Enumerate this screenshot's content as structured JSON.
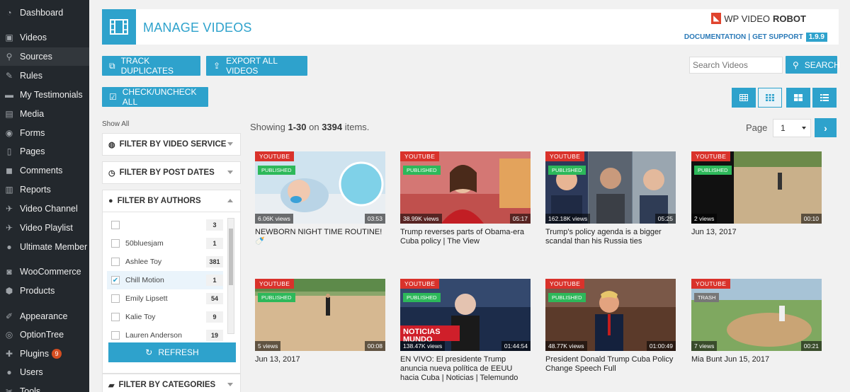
{
  "sidebar": {
    "items": [
      {
        "label": "Dashboard",
        "icon": "dashboard-icon",
        "glyph": "◔"
      },
      {
        "label": "Videos",
        "icon": "videos-icon",
        "glyph": "▣"
      },
      {
        "label": "Sources",
        "icon": "search-icon",
        "glyph": "⚲"
      },
      {
        "label": "Rules",
        "icon": "rules-icon",
        "glyph": "✎"
      },
      {
        "label": "My Testimonials",
        "icon": "testimonials-icon",
        "glyph": "▬"
      },
      {
        "label": "Media",
        "icon": "media-icon",
        "glyph": "▤"
      },
      {
        "label": "Forms",
        "icon": "forms-icon",
        "glyph": "◉"
      },
      {
        "label": "Pages",
        "icon": "pages-icon",
        "glyph": "▯"
      },
      {
        "label": "Comments",
        "icon": "comments-icon",
        "glyph": "◼"
      },
      {
        "label": "Reports",
        "icon": "reports-icon",
        "glyph": "▥"
      },
      {
        "label": "Video Channel",
        "icon": "pin-icon",
        "glyph": "✈"
      },
      {
        "label": "Video Playlist",
        "icon": "pin-icon",
        "glyph": "✈"
      },
      {
        "label": "Ultimate Member",
        "icon": "user-icon",
        "glyph": "●"
      },
      {
        "label": "WooCommerce",
        "icon": "woocommerce-icon",
        "glyph": "◙"
      },
      {
        "label": "Products",
        "icon": "products-icon",
        "glyph": "⬢"
      },
      {
        "label": "Appearance",
        "icon": "appearance-icon",
        "glyph": "✐"
      },
      {
        "label": "OptionTree",
        "icon": "optiontree-icon",
        "glyph": "◎"
      },
      {
        "label": "Plugins",
        "icon": "plugins-icon",
        "glyph": "✚",
        "badge": "9"
      },
      {
        "label": "Users",
        "icon": "users-icon",
        "glyph": "●"
      },
      {
        "label": "Tools",
        "icon": "tools-icon",
        "glyph": "✂"
      }
    ]
  },
  "header": {
    "title": "MANAGE VIDEOS",
    "logo_wp": "WP VIDEO",
    "logo_robot": "ROBOT",
    "documentation": "DOCUMENTATION",
    "separator": "|",
    "support": "GET SUPPORT",
    "version": "1.9.9"
  },
  "toolbar": {
    "track_duplicates": "TRACK DUPLICATES",
    "export_all": "EXPORT ALL VIDEOS",
    "check_all": "CHECK/UNCHECK ALL",
    "search_placeholder": "Search Videos",
    "search_label": "SEARCH"
  },
  "filters": {
    "show_all": "Show All",
    "video_service": "FILTER BY VIDEO SERVICE",
    "post_dates": "FILTER BY POST DATES",
    "authors": "FILTER BY AUTHORS",
    "categories": "FILTER BY CATEGORIES",
    "refresh": "REFRESH",
    "author_list": [
      {
        "name": "",
        "count": "3",
        "checked": false
      },
      {
        "name": "50bluesjam",
        "count": "1",
        "checked": false
      },
      {
        "name": "Ashlee Toy",
        "count": "381",
        "checked": false
      },
      {
        "name": "Chill Motion",
        "count": "1",
        "checked": true
      },
      {
        "name": "Emily Lipsett",
        "count": "54",
        "checked": false
      },
      {
        "name": "Kalie Toy",
        "count": "9",
        "checked": false
      },
      {
        "name": "Lauren Anderson",
        "count": "19",
        "checked": false
      }
    ]
  },
  "listing": {
    "showing_prefix": "Showing ",
    "range": "1-30",
    "on": " on ",
    "total": "3394",
    "suffix": " items.",
    "page_label": "Page",
    "page_value": "1"
  },
  "videos": [
    {
      "service": "YOUTUBE",
      "status": "PUBLISHED",
      "views": "6.06K views",
      "duration": "03:53",
      "title": "NEWBORN NIGHT TIME ROUTINE! 🍼",
      "scene": "baby"
    },
    {
      "service": "YOUTUBE",
      "status": "PUBLISHED",
      "views": "38.99K views",
      "duration": "05:17",
      "title": "Trump reverses parts of Obama-era Cuba policy | The View",
      "scene": "studio"
    },
    {
      "service": "YOUTUBE",
      "status": "PUBLISHED",
      "views": "162.18K views",
      "duration": "05:25",
      "title": "Trump's policy agenda is a bigger scandal than his Russia ties",
      "scene": "panel"
    },
    {
      "service": "YOUTUBE",
      "status": "PUBLISHED",
      "views": "2 views",
      "duration": "00:10",
      "title": "Jun 13, 2017",
      "scene": "field-dark"
    },
    {
      "service": "YOUTUBE",
      "status": "PUBLISHED",
      "views": "5 views",
      "duration": "00:08",
      "title": "Jun 13, 2017",
      "scene": "field"
    },
    {
      "service": "YOUTUBE",
      "status": "PUBLISHED",
      "views": "138.47K views",
      "duration": "01:44:54",
      "title": "EN VIVO: El presidente Trump anuncia nueva política de EEUU hacia Cuba | Noticias | Telemundo",
      "scene": "noticias",
      "overlay": "NOTICIAS MUNDO"
    },
    {
      "service": "YOUTUBE",
      "status": "PUBLISHED",
      "views": "48.77K views",
      "duration": "01:00:49",
      "title": "President Donald Trump Cuba Policy Change Speech Full",
      "scene": "speech"
    },
    {
      "service": "YOUTUBE",
      "status": "TRASH",
      "views": "7 views",
      "duration": "00:21",
      "title": "Mia Bunt Jun 15, 2017",
      "scene": "field-green"
    }
  ]
}
